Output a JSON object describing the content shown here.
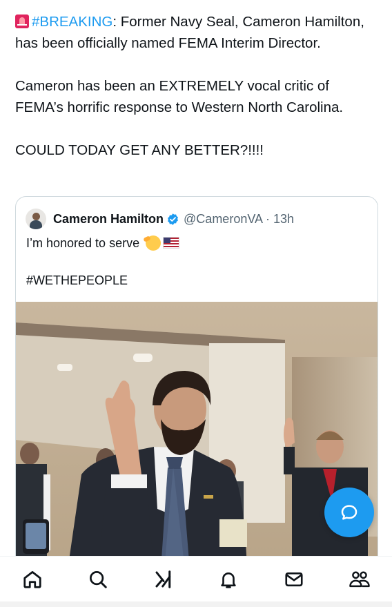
{
  "post": {
    "hashtag": "#BREAKING",
    "headline_rest": ": Former Navy Seal, Cameron Hamilton, has been officially named FEMA Interim Director.",
    "paragraph2": "Cameron has been an EXTREMELY vocal critic of FEMA’s horrific response to Western North Carolina.",
    "paragraph3": "COULD TODAY GET ANY BETTER?!!!!",
    "siren_icon": "police-light-emoji"
  },
  "quote": {
    "author_name": "Cameron Hamilton",
    "handle_time": "@CameronVA · 13h",
    "verified": true,
    "line1": "I’m honored to serve",
    "line2": "#WETHEPEOPLE",
    "emoji": [
      "saluting-face-emoji",
      "us-flag-emoji"
    ]
  },
  "fab": {
    "icon": "chat-bubble-icon",
    "color": "#1d9bf0"
  },
  "nav": {
    "items": [
      {
        "id": "home",
        "icon": "home-icon"
      },
      {
        "id": "search",
        "icon": "search-icon"
      },
      {
        "id": "grok",
        "icon": "grok-icon"
      },
      {
        "id": "notifications",
        "icon": "bell-icon"
      },
      {
        "id": "messages",
        "icon": "mail-icon"
      },
      {
        "id": "communities",
        "icon": "people-icon"
      }
    ]
  },
  "colors": {
    "accent": "#1d9bf0",
    "text": "#0f1419",
    "secondary": "#536471",
    "border": "#cfd9de"
  }
}
